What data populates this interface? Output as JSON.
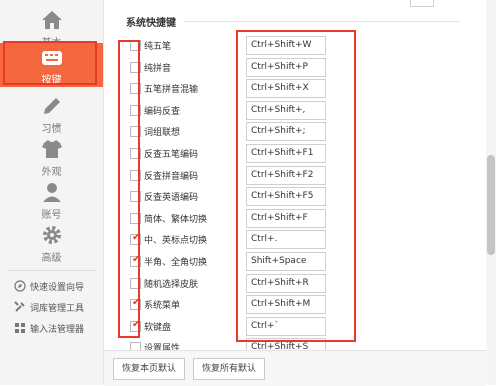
{
  "sidebar": {
    "items": [
      {
        "label": "基本",
        "icon": "home-icon"
      },
      {
        "label": "按键",
        "icon": "keyboard-icon",
        "active": true
      },
      {
        "label": "习惯",
        "icon": "pencil-icon"
      },
      {
        "label": "外观",
        "icon": "shirt-icon"
      },
      {
        "label": "账号",
        "icon": "user-icon"
      },
      {
        "label": "高级",
        "icon": "gear-icon"
      }
    ],
    "tools": [
      {
        "label": "快速设置向导",
        "icon": "compass-icon"
      },
      {
        "label": "词库管理工具",
        "icon": "wrench-icon"
      },
      {
        "label": "输入法管理器",
        "icon": "grid-icon"
      }
    ]
  },
  "main": {
    "section_title": "系统快捷键",
    "rows": [
      {
        "label": "纯五笔",
        "key": "Ctrl+Shift+W",
        "checked": false
      },
      {
        "label": "纯拼音",
        "key": "Ctrl+Shift+P",
        "checked": false
      },
      {
        "label": "五笔拼音混输",
        "key": "Ctrl+Shift+X",
        "checked": false
      },
      {
        "label": "编码反查",
        "key": "Ctrl+Shift+,",
        "checked": false
      },
      {
        "label": "词组联想",
        "key": "Ctrl+Shift+;",
        "checked": false
      },
      {
        "label": "反查五笔编码",
        "key": "Ctrl+Shift+F1",
        "checked": false
      },
      {
        "label": "反查拼音编码",
        "key": "Ctrl+Shift+F2",
        "checked": false
      },
      {
        "label": "反查英语编码",
        "key": "Ctrl+Shift+F5",
        "checked": false
      },
      {
        "label": "简体、繁体切换",
        "key": "Ctrl+Shift+F",
        "checked": false
      },
      {
        "label": "中、英标点切换",
        "key": "Ctrl+.",
        "checked": true
      },
      {
        "label": "半角、全角切换",
        "key": "Shift+Space",
        "checked": true
      },
      {
        "label": "随机选择皮肤",
        "key": "Ctrl+Shift+R",
        "checked": false
      },
      {
        "label": "系统菜单",
        "key": "Ctrl+Shift+M",
        "checked": true
      },
      {
        "label": "软键盘",
        "key": "Ctrl+`",
        "checked": true
      },
      {
        "label": "设置属性",
        "key": "Ctrl+Shift+S",
        "checked": false
      }
    ]
  },
  "footer": {
    "reset_page_label": "恢复本页默认",
    "reset_all_label": "恢复所有默认"
  },
  "colors": {
    "accent": "#f5683f",
    "highlight_red": "#e8392a"
  }
}
